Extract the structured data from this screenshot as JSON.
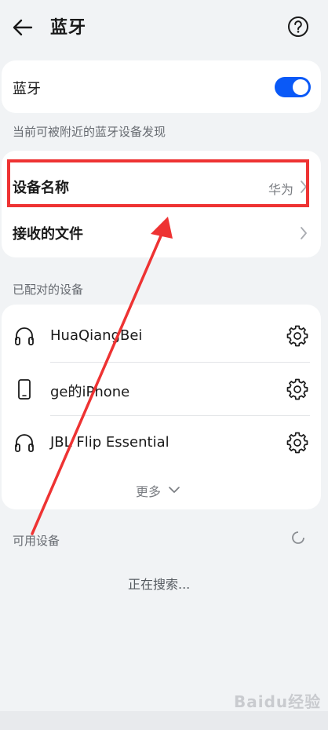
{
  "header": {
    "title": "蓝牙"
  },
  "bluetooth": {
    "label": "蓝牙",
    "enabled": true,
    "accent_color": "#0a59f7"
  },
  "discoverable_caption": "当前可被附近的蓝牙设备发现",
  "settings": {
    "device_name_label": "设备名称",
    "device_name_value": "华为",
    "received_files_label": "接收的文件"
  },
  "paired": {
    "caption": "已配对的设备",
    "devices": [
      {
        "name": "HuaQiangBei",
        "icon": "headphones-icon"
      },
      {
        "name": "ge的iPhone",
        "icon": "phone-icon"
      },
      {
        "name": "JBL Flip Essential",
        "icon": "headphones-icon"
      }
    ],
    "more_label": "更多"
  },
  "available": {
    "caption": "可用设备",
    "status": "正在搜索..."
  },
  "annotation": {
    "color": "#ee3333"
  },
  "watermark": {
    "text": "Baidu经验"
  }
}
